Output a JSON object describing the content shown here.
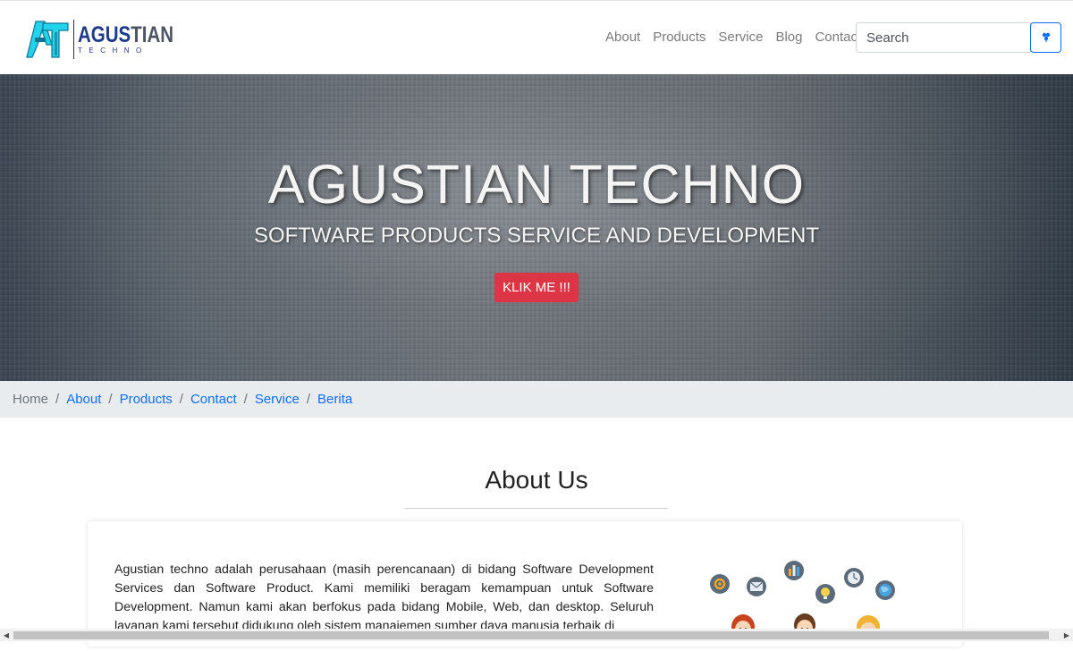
{
  "brand": {
    "name_part1": "AGUS",
    "name_part2": "TIAN",
    "sub": "TECHNO",
    "logo_icon": "at-monogram-logo"
  },
  "nav": {
    "links": [
      "About",
      "Products",
      "Service",
      "Blog",
      "Contact"
    ]
  },
  "search": {
    "placeholder": "Search",
    "button_icon": "search-icon"
  },
  "hero": {
    "title": "AGUSTIAN TECHNO",
    "subtitle": "SOFTWARE PRODUCTS SERVICE AND DEVELOPMENT",
    "button_label": "KLIK ME !!!"
  },
  "breadcrumb": {
    "home": "Home",
    "items": [
      "About",
      "Products",
      "Contact",
      "Service",
      "Berita"
    ],
    "separator": "/"
  },
  "about": {
    "title": "About Us",
    "text": "Agustian techno adalah perusahaan (masih perencanaan) di bidang Software Development Services dan Software Product. Kami memiliki beragam kemampuan untuk Software Development. Namun kami akan berfokus pada bidang Mobile, Web, dan desktop. Seluruh layanan kami tersebut didukung oleh sistem manajemen sumber daya manusia terbaik di"
  },
  "colors": {
    "primary": "#0d6efd",
    "danger": "#dc3545",
    "brand_blue": "#1e3a8a",
    "logo_cyan": "#22d3ee"
  }
}
